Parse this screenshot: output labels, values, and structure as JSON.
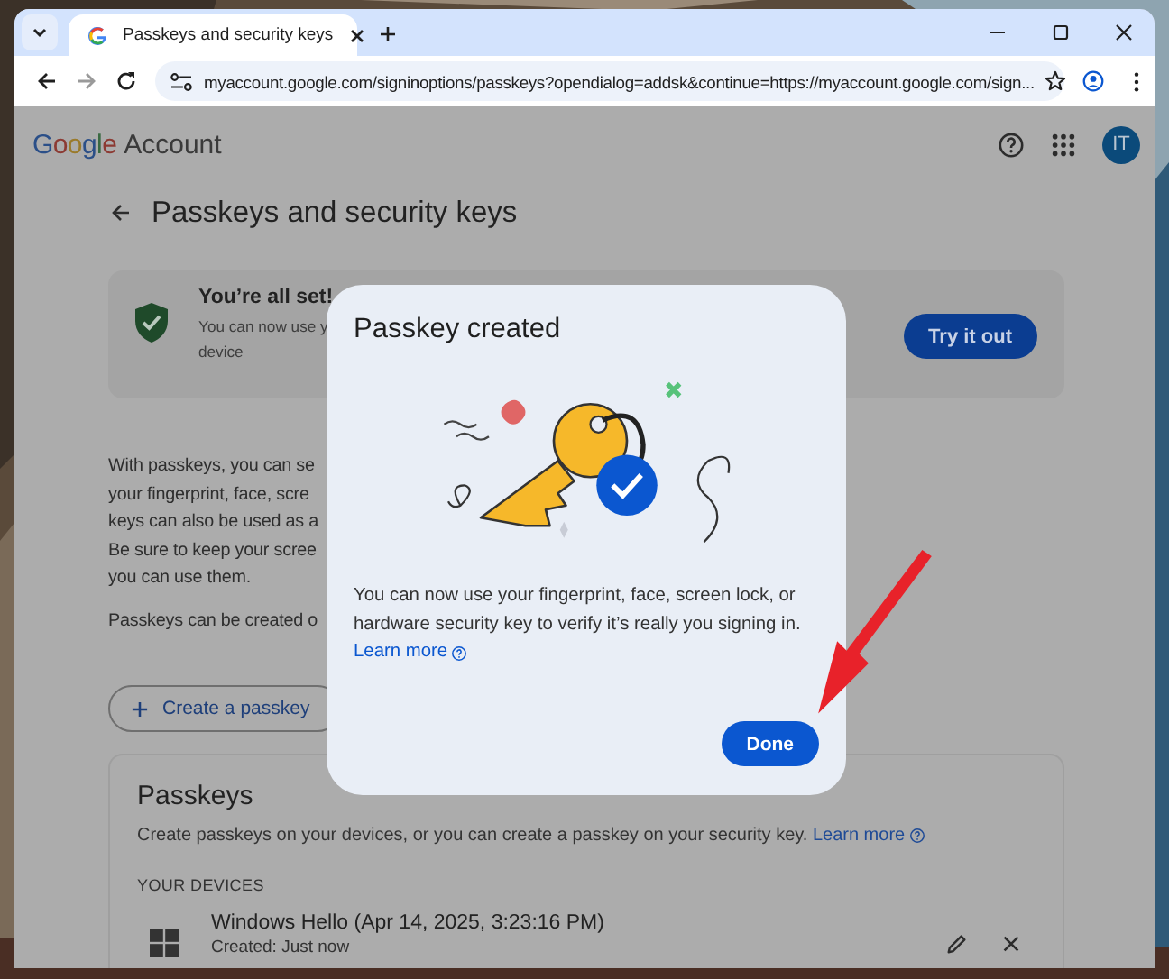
{
  "browser": {
    "tab": {
      "title": "Passkeys and security keys",
      "selected": true
    },
    "url": "myaccount.google.com/signinoptions/passkeys?opendialog=addsk&continue=https://myaccount.google.com/sign..."
  },
  "header": {
    "logo_word": "Google",
    "product": "Account",
    "avatar_initials": "IT"
  },
  "page": {
    "title": "Passkeys and security keys",
    "status_card": {
      "title": "You’re all set!",
      "lines": [
        "You can now use y",
        "device"
      ],
      "button": "Try it out"
    },
    "intro_lines": [
      "With passkeys, you can se",
      "your fingerprint, face, scre",
      "keys can also be used as a",
      "Be sure to keep your scree",
      "you can use them."
    ],
    "note_line": "Passkeys can be created o",
    "create_button": "Create a passkey",
    "passkeys": {
      "title": "Passkeys",
      "description": "Create passkeys on your devices, or you can create a passkey on your security key.",
      "link": "Learn more",
      "section_label": "YOUR DEVICES",
      "devices": [
        {
          "name": "Windows Hello (Apr 14, 2025, 3:23:16 PM)",
          "created": "Created: Just now"
        }
      ]
    }
  },
  "dialog": {
    "title": "Passkey created",
    "body": "You can now use your fingerprint, face, screen lock, or hardware security key to verify it’s really you signing in.",
    "link": "Learn more",
    "button": "Done"
  }
}
